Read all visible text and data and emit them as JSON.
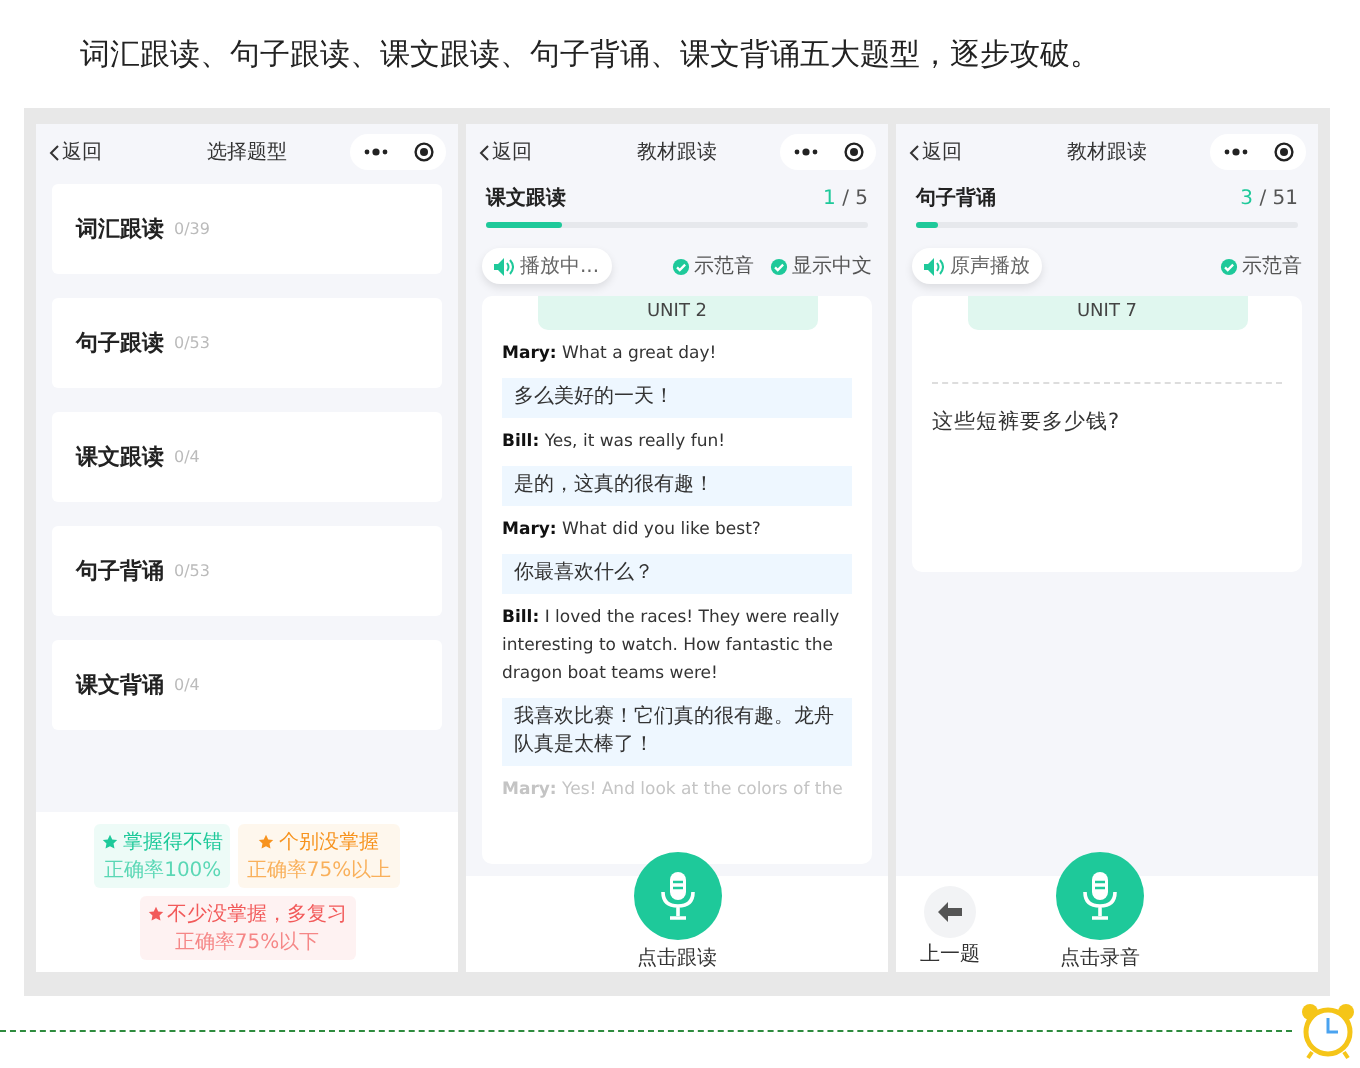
{
  "heading": "词汇跟读、句子跟读、课文跟读、句子背诵、课文背诵五大题型，逐步攻破。",
  "screens": [
    {
      "kind": "types",
      "nav": {
        "back": "返回",
        "title": "选择题型"
      },
      "types": [
        {
          "name": "词汇跟读",
          "count": "0/39"
        },
        {
          "name": "句子跟读",
          "count": "0/53"
        },
        {
          "name": "课文跟读",
          "count": "0/4"
        },
        {
          "name": "句子背诵",
          "count": "0/53"
        },
        {
          "name": "课文背诵",
          "count": "0/4"
        }
      ],
      "legend": [
        {
          "label": "掌握得不错",
          "note": "正确率100%",
          "color": "#1ec99a"
        },
        {
          "label": "个别没掌握",
          "note": "正确率75%以上",
          "color": "#f7931e"
        },
        {
          "label": "不少没掌握，多复习",
          "note": "正确率75%以下",
          "color": "#f25a5a"
        }
      ]
    },
    {
      "kind": "dialogue",
      "nav": {
        "back": "返回",
        "title": "教材跟读"
      },
      "section": "课文跟读",
      "current": "1",
      "total": "/ 5",
      "level": 0.2,
      "play": "播放中...",
      "toggles": [
        {
          "label": "示范音",
          "checked": true
        },
        {
          "label": "显示中文",
          "checked": true
        }
      ],
      "unit": "UNIT 2",
      "lines": [
        {
          "kind": "english",
          "text": "**Mary:** What a great day!",
          "faded": false
        },
        {
          "kind": "chinese",
          "text": "多么美好的一天！",
          "faded": false
        },
        {
          "kind": "english",
          "text": "**Bill:** Yes, it was really fun!",
          "faded": false
        },
        {
          "kind": "chinese",
          "text": "是的，这真的很有趣！",
          "faded": false
        },
        {
          "kind": "english",
          "text": "**Mary:** What did you like best?",
          "faded": false
        },
        {
          "kind": "chinese",
          "text": "你最喜欢什么？",
          "faded": false
        },
        {
          "kind": "english",
          "text": "**Bill:** I loved the races! They were really interesting to watch. How fantastic the dragon boat teams were!",
          "faded": false
        },
        {
          "kind": "chinese",
          "text": "我喜欢比赛！它们真的很有趣。龙舟队真是太棒了！",
          "faded": false
        },
        {
          "kind": "english",
          "text": "**Mary:** Yes! And look at the colors of the",
          "faded": true
        }
      ],
      "mic": "点击跟读"
    },
    {
      "kind": "recite",
      "nav": {
        "back": "返回",
        "title": "教材跟读"
      },
      "section": "句子背诵",
      "current": "3",
      "total": "/ 51",
      "level": 0.06,
      "play": "原声播放",
      "toggles": [
        {
          "label": "示范音",
          "checked": true
        }
      ],
      "unit": "UNIT 7",
      "sentence": "这些短裤要多少钱?",
      "prev": "上一题",
      "mic": "点击录音"
    }
  ]
}
